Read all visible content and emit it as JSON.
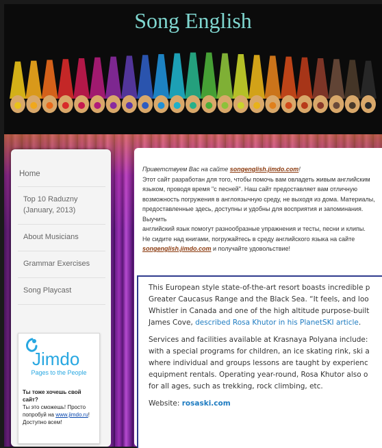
{
  "header": {
    "title": "Song English"
  },
  "sidebar": {
    "nav": [
      {
        "label": "Home"
      },
      {
        "label": "Top 10 Raduzny (January, 2013)"
      },
      {
        "label": "About Musicians"
      },
      {
        "label": "Grammar Exercises"
      },
      {
        "label": "Song Playcast"
      }
    ],
    "jimdo": {
      "logo": "Jimdo",
      "tagline": "Pages to the People",
      "heading": "Ты тоже хочешь свой сайт?",
      "line1": "Ты это сможешь! Просто",
      "line2_prefix": "попробуй на ",
      "link": "www.jimdo.ru",
      "line2_suffix": "!",
      "line3": "Доступно всем!"
    }
  },
  "intro": {
    "greeting": "Приветствуем Вас на сайте ",
    "site_link": "songenglish.jimdo.com",
    "greeting_end": "!",
    "lines": [
      "Этот сайт разработан для того, чтобы помочь вам овладеть живым английским",
      "языком, проводя время \"с песней\". Наш сайт предоставляет вам отличную",
      "возможность погружения в англоязычную среду, не выходя из дома. Материалы,",
      "предоставленные здесь, доступны и удобны для восприятия и запоминания. Выучить",
      "английский язык помогут разнообразные упражнения и тесты, песни и клипы.",
      "Не сидите над книгами, погружайтесь в среду английского языка на сайте"
    ],
    "final_link": "songenglish.jimdo.com",
    "final_text": " и получайте удовольствие!"
  },
  "resort": {
    "p1": [
      "This European style state-of-the-art resort boasts incredible p",
      "Greater Caucasus Range and the Black Sea. “It feels, and loo",
      "Whistler in Canada and one of the high altitude purpose-built"
    ],
    "p1_last_prefix": "James Cove, ",
    "p1_link": "described Rosa Khutor in his PlanetSKI article",
    "p1_last_suffix": ".",
    "p2": [
      "Services and facilities available at Krasnaya Polyana include:",
      "with a special programs for children, an ice skating rink, ski a",
      "where individual and groups lessons are taught by experienc",
      "equipment rentals. Operating year-round, Rosa Khutor also o",
      "for all ages, such as trekking, rock climbing, etc."
    ],
    "website_label": "Website: ",
    "website": "rosaski.com"
  }
}
